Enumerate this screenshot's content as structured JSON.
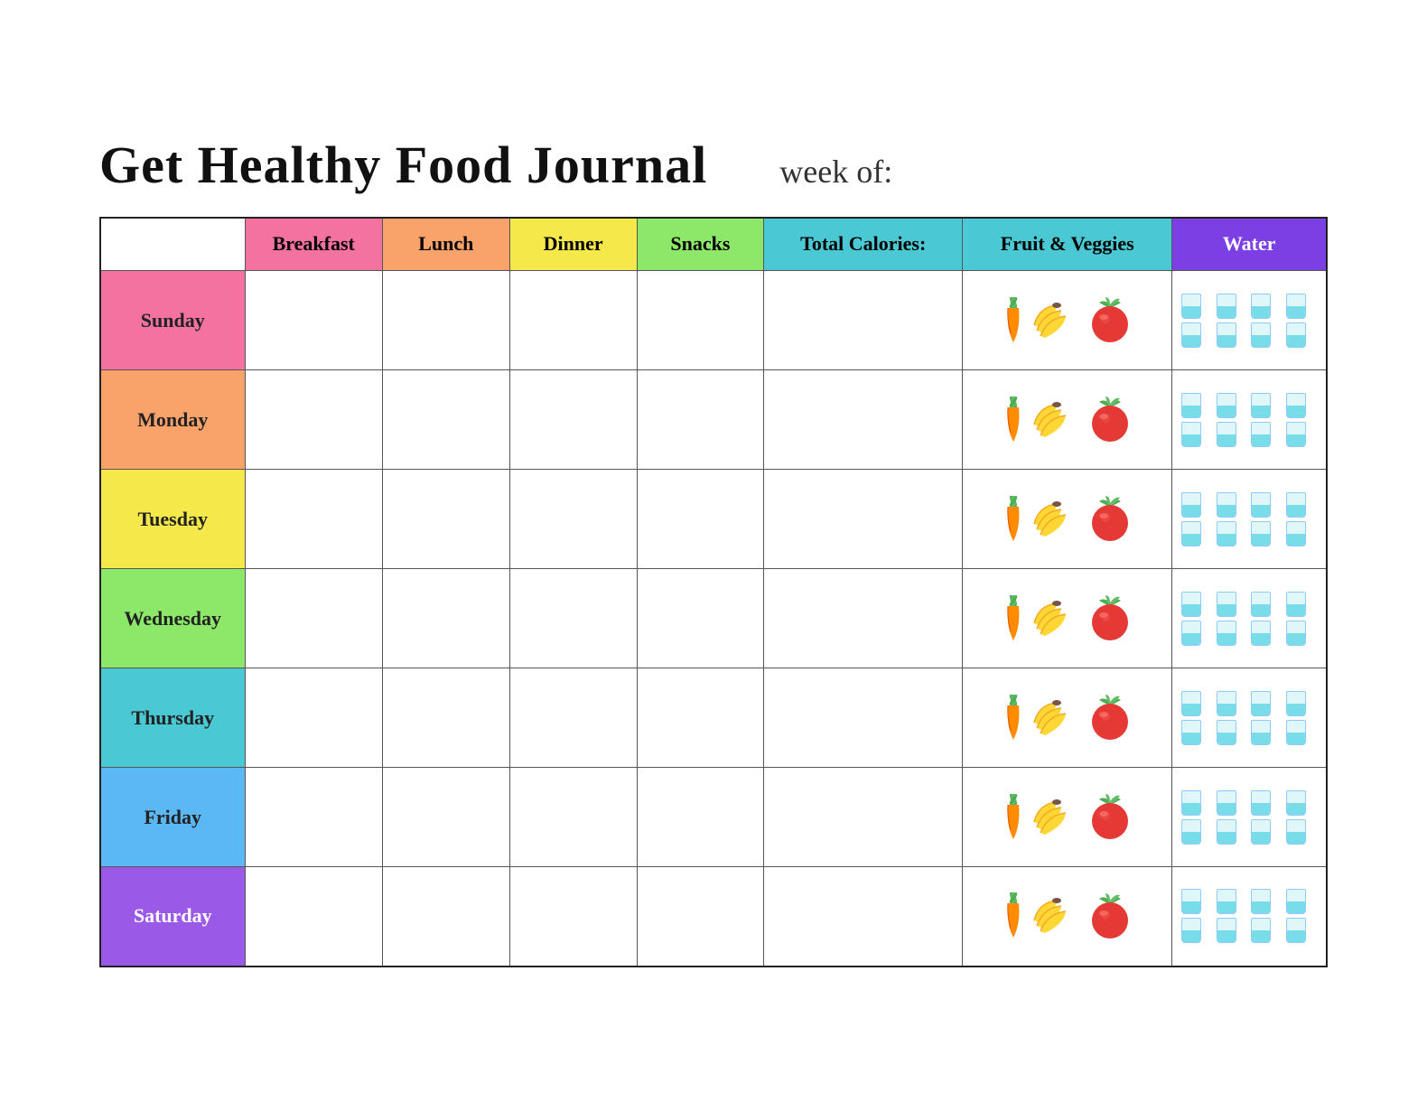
{
  "header": {
    "title": "Get Healthy Food Journal",
    "week_of_label": "week of:"
  },
  "columns": {
    "breakfast": "Breakfast",
    "lunch": "Lunch",
    "dinner": "Dinner",
    "snacks": "Snacks",
    "calories": "Total Calories:",
    "fruits": "Fruit & Veggies",
    "water": "Water"
  },
  "days": [
    {
      "name": "Sunday",
      "class": "day-sunday"
    },
    {
      "name": "Monday",
      "class": "day-monday"
    },
    {
      "name": "Tuesday",
      "class": "day-tuesday"
    },
    {
      "name": "Wednesday",
      "class": "day-wednesday"
    },
    {
      "name": "Thursday",
      "class": "day-thursday"
    },
    {
      "name": "Friday",
      "class": "day-friday"
    },
    {
      "name": "Saturday",
      "class": "day-saturday"
    }
  ],
  "colors": {
    "breakfast_bg": "#f472a0",
    "lunch_bg": "#f9a26a",
    "dinner_bg": "#f5e84a",
    "snacks_bg": "#8de86a",
    "calories_bg": "#4ac8d4",
    "fruits_bg": "#4ac8d4",
    "water_bg": "#7c3fe4"
  }
}
